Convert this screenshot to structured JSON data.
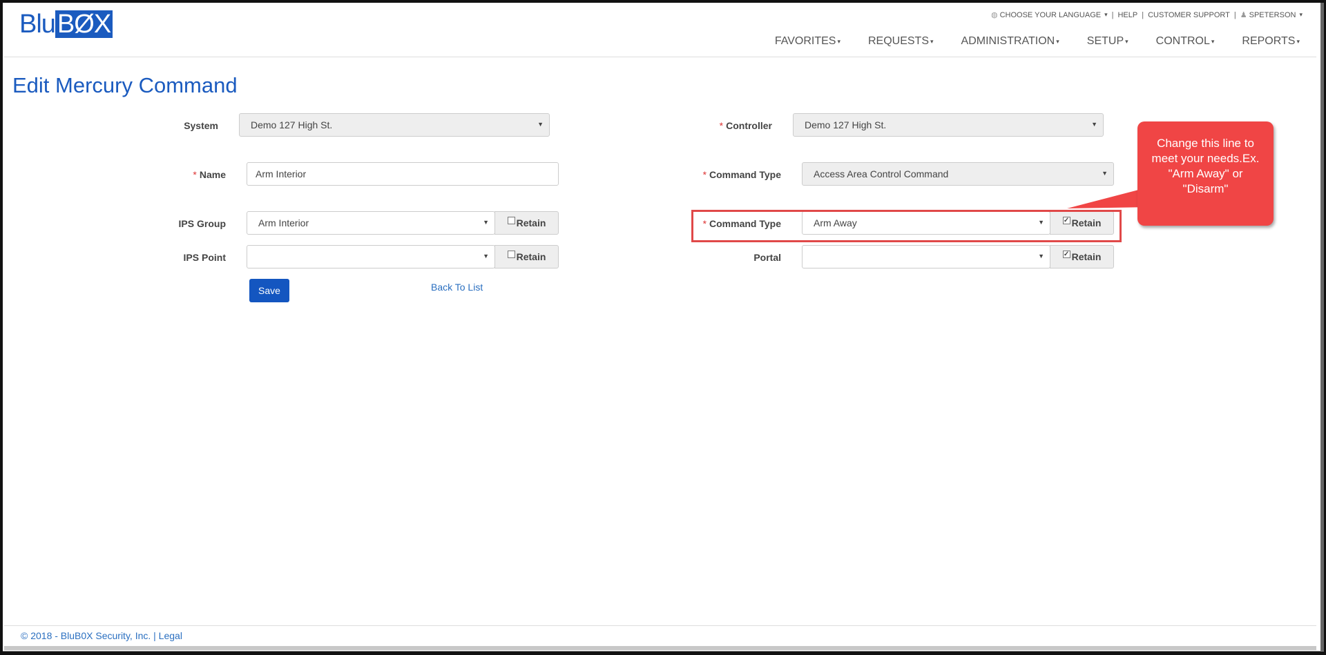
{
  "logo": {
    "part1": "Blu",
    "part2": "BØX"
  },
  "util": {
    "language": "CHOOSE YOUR LANGUAGE",
    "help": "HELP",
    "support": "CUSTOMER SUPPORT",
    "user": "SPETERSON"
  },
  "nav": [
    "FAVORITES",
    "REQUESTS",
    "ADMINISTRATION",
    "SETUP",
    "CONTROL",
    "REPORTS"
  ],
  "page": {
    "title": "Edit Mercury Command"
  },
  "form": {
    "system": {
      "label": "System",
      "value": "Demo 127 High St."
    },
    "name": {
      "label": "Name",
      "value": "Arm Interior"
    },
    "ips_group": {
      "label": "IPS Group",
      "value": "Arm Interior",
      "retain": "Retain"
    },
    "ips_point": {
      "label": "IPS Point",
      "value": "",
      "retain": "Retain"
    },
    "controller": {
      "label": "Controller",
      "value": "Demo 127 High St."
    },
    "command_type": {
      "label": "Command Type",
      "value": "Access Area Control Command"
    },
    "command_type2": {
      "label": "Command Type",
      "value": "Arm Away",
      "retain": "Retain"
    },
    "portal": {
      "label": "Portal",
      "value": "",
      "retain": "Retain"
    },
    "required_marker": "*",
    "save": "Save",
    "back": "Back To List"
  },
  "callout": {
    "text": "Change this line to meet your needs.Ex. \"Arm Away\" or \"Disarm\""
  },
  "footer": {
    "text": "© 2018 - BluB0X Security, Inc. | Legal"
  },
  "colors": {
    "brand": "#1b5bbf",
    "callout": "#f04545",
    "highlight": "#e04848"
  },
  "icons": {
    "language": "globe-icon",
    "user": "user-icon",
    "dropdown": "caret-down-icon"
  }
}
